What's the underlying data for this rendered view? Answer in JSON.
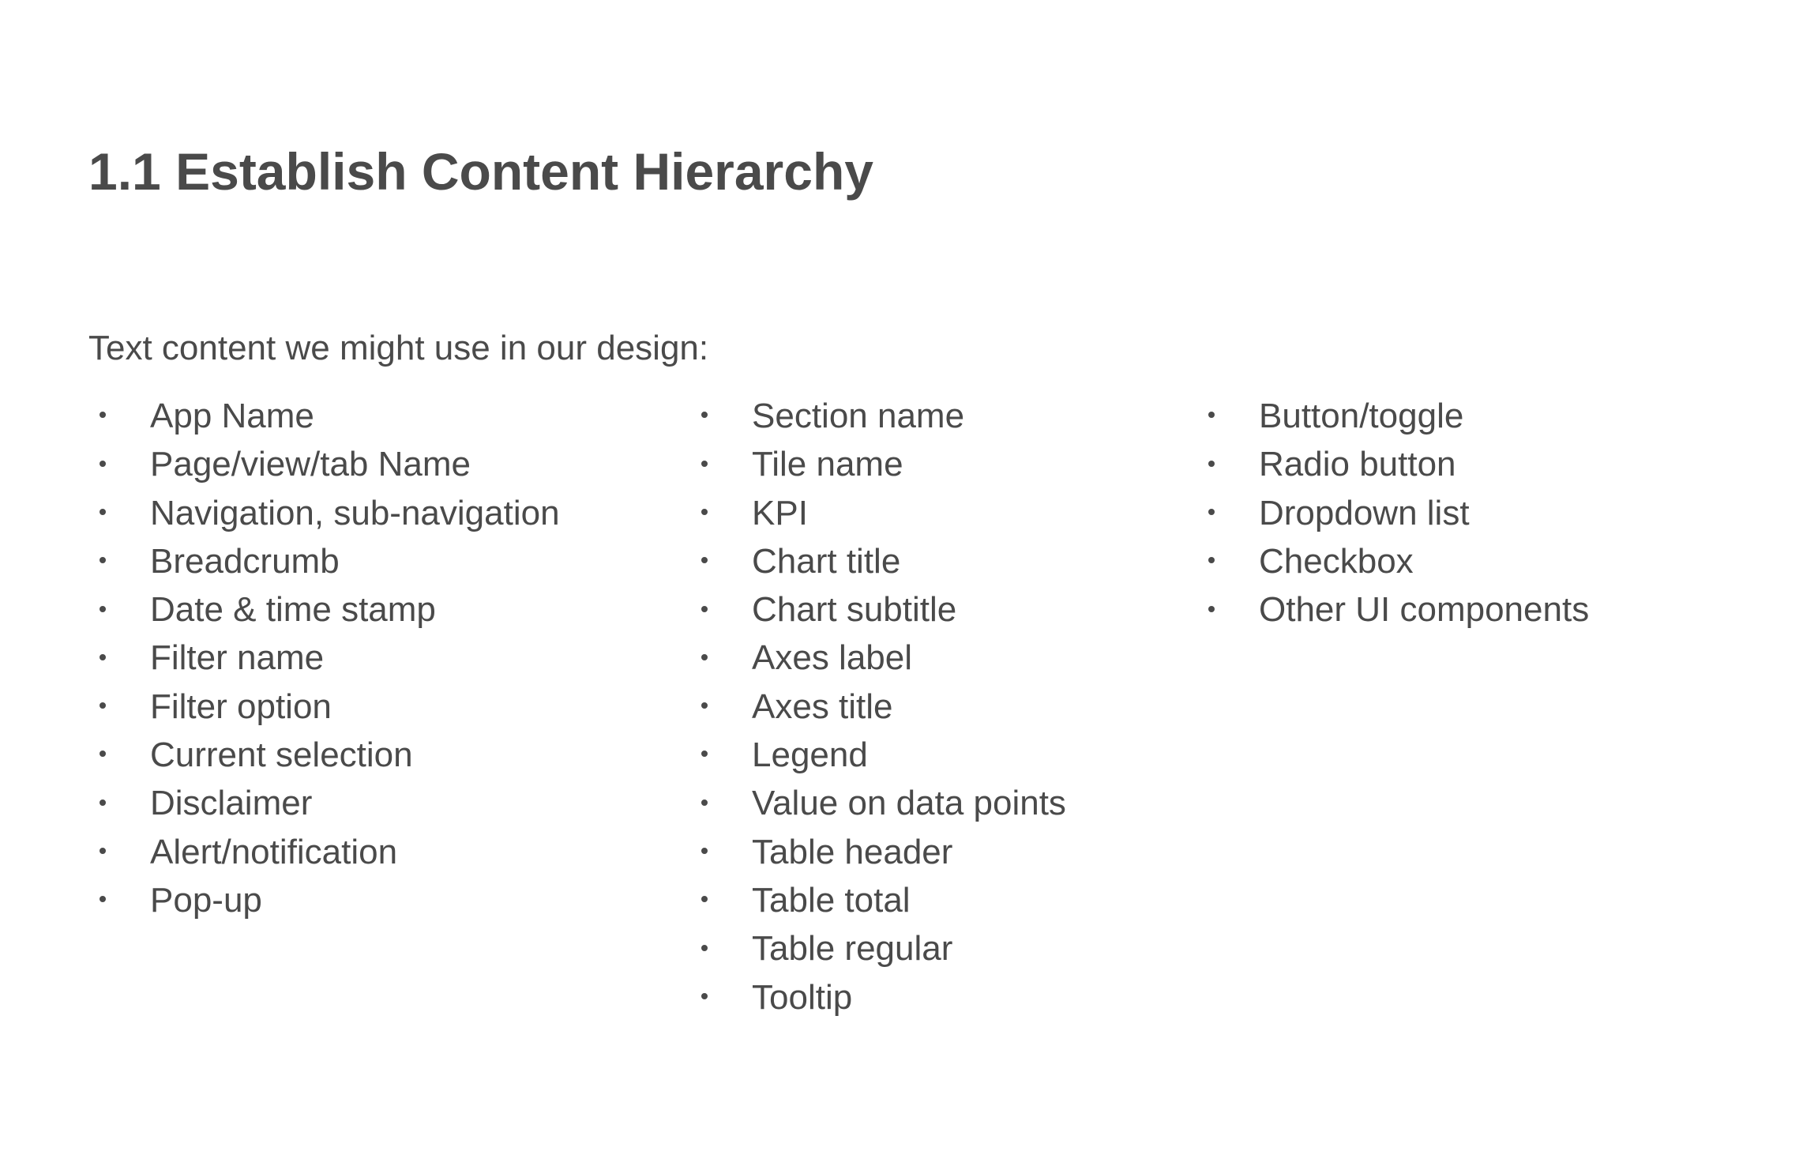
{
  "title": "1.1 Establish Content Hierarchy",
  "intro": "Text content we might use in our design:",
  "columns": [
    {
      "items": [
        "App Name",
        "Page/view/tab Name",
        "Navigation, sub-navigation",
        "Breadcrumb",
        "Date & time stamp",
        "Filter name",
        "Filter option",
        "Current selection",
        "Disclaimer",
        "Alert/notification",
        "Pop-up"
      ]
    },
    {
      "items": [
        "Section name",
        "Tile name",
        "KPI",
        "Chart title",
        "Chart subtitle",
        "Axes label",
        "Axes title",
        "Legend",
        "Value on data points",
        "Table header",
        "Table total",
        "Table regular",
        "Tooltip"
      ]
    },
    {
      "items": [
        "Button/toggle",
        "Radio button",
        "Dropdown list",
        "Checkbox",
        "Other UI components"
      ]
    }
  ]
}
